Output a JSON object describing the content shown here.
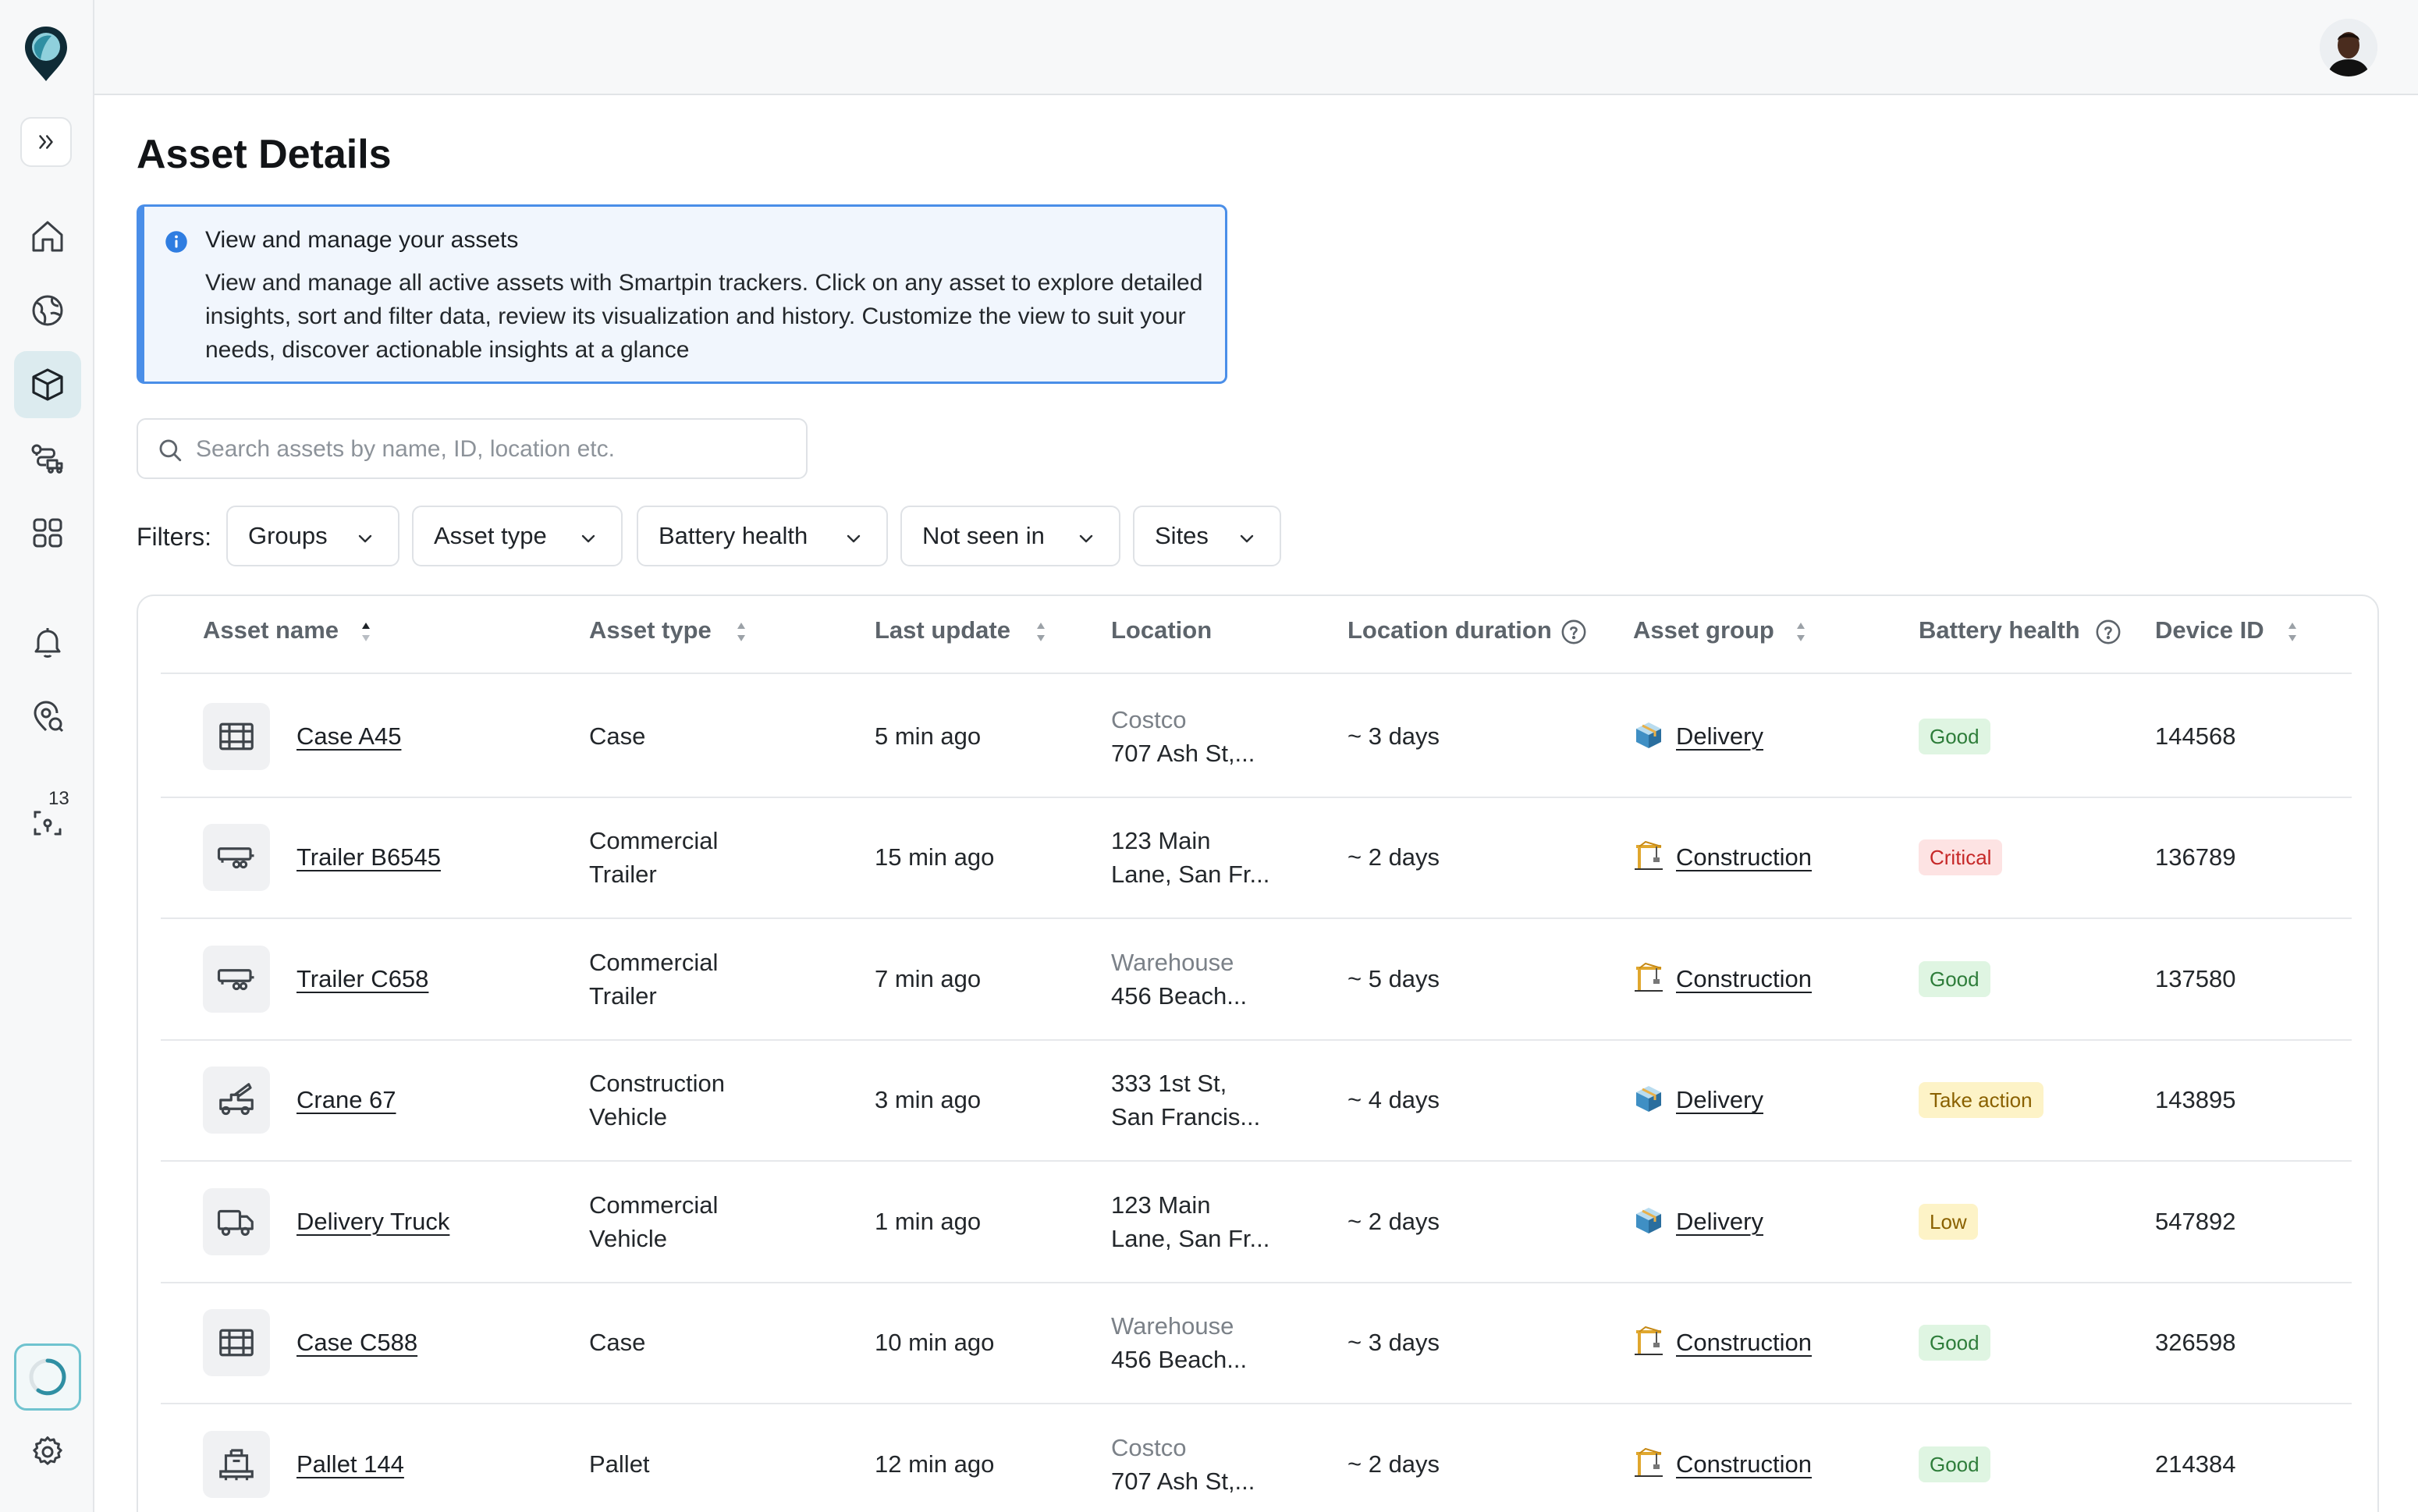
{
  "sidebar": {
    "badge_count": "13",
    "nav": [
      {
        "name": "home",
        "icon": "home-icon"
      },
      {
        "name": "globe",
        "icon": "globe-icon"
      },
      {
        "name": "assets",
        "icon": "cube-icon",
        "active": true
      },
      {
        "name": "routes",
        "icon": "truck-route-icon"
      },
      {
        "name": "apps",
        "icon": "grid-icon"
      },
      {
        "name": "alerts",
        "icon": "bell-icon"
      },
      {
        "name": "location",
        "icon": "pin-icon"
      },
      {
        "name": "scan",
        "icon": "scan-icon"
      }
    ]
  },
  "page": {
    "title": "Asset Details"
  },
  "info": {
    "title": "View and manage your assets",
    "body": "View and manage all active assets with Smartpin trackers. Click on any asset to explore detailed insights, sort and filter data, review its visualization and history. Customize the view to suit your needs, discover actionable insights at a glance"
  },
  "search": {
    "placeholder": "Search assets by name, ID, location etc."
  },
  "filters": {
    "label": "Filters:",
    "items": [
      "Groups",
      "Asset type",
      "Battery health",
      "Not seen in",
      "Sites"
    ]
  },
  "table": {
    "columns": [
      "Asset name",
      "Asset type",
      "Last update",
      "Location",
      "Location duration",
      "Asset group",
      "Battery health",
      "Device ID"
    ],
    "rows": [
      {
        "name": "Case A45",
        "icon": "case-icon",
        "type1": "Case",
        "type2": "",
        "updated": "5 min ago",
        "loc1": "Costco",
        "loc1_muted": true,
        "loc2": "707 Ash St,...",
        "duration": "~ 3 days",
        "group": "Delivery",
        "group_icon": "box-icon",
        "battery": "Good",
        "battery_class": "good",
        "device": "144568"
      },
      {
        "name": "Trailer B6545",
        "icon": "trailer-icon",
        "type1": "Commercial",
        "type2": "Trailer",
        "updated": "15 min ago",
        "loc1": "123 Main",
        "loc1_muted": false,
        "loc2": "Lane, San Fr...",
        "duration": "~ 2 days",
        "group": "Construction",
        "group_icon": "crane-icon",
        "battery": "Critical",
        "battery_class": "critical",
        "device": "136789"
      },
      {
        "name": "Trailer C658",
        "icon": "trailer-icon",
        "type1": "Commercial",
        "type2": "Trailer",
        "updated": "7 min ago",
        "loc1": "Warehouse",
        "loc1_muted": true,
        "loc2": "456 Beach...",
        "duration": "~ 5 days",
        "group": "Construction",
        "group_icon": "crane-icon",
        "battery": "Good",
        "battery_class": "good",
        "device": "137580"
      },
      {
        "name": "Crane 67",
        "icon": "crane-truck-icon",
        "type1": "Construction",
        "type2": "Vehicle",
        "updated": "3 min ago",
        "loc1": "333 1st St,",
        "loc1_muted": false,
        "loc2": "San Francis...",
        "duration": "~ 4 days",
        "group": "Delivery",
        "group_icon": "box-icon",
        "battery": "Take action",
        "battery_class": "take",
        "device": "143895"
      },
      {
        "name": "Delivery Truck",
        "icon": "truck-icon",
        "type1": "Commercial",
        "type2": "Vehicle",
        "updated": "1 min ago",
        "loc1": "123 Main",
        "loc1_muted": false,
        "loc2": "Lane, San Fr...",
        "duration": "~ 2 days",
        "group": "Delivery",
        "group_icon": "box-icon",
        "battery": "Low",
        "battery_class": "low",
        "device": "547892"
      },
      {
        "name": "Case C588",
        "icon": "case-icon",
        "type1": "Case",
        "type2": "",
        "updated": "10 min ago",
        "loc1": "Warehouse",
        "loc1_muted": true,
        "loc2": "456 Beach...",
        "duration": "~ 3 days",
        "group": "Construction",
        "group_icon": "crane-icon",
        "battery": "Good",
        "battery_class": "good",
        "device": "326598"
      },
      {
        "name": "Pallet 144",
        "icon": "pallet-icon",
        "type1": "Pallet",
        "type2": "",
        "updated": "12 min ago",
        "loc1": "Costco",
        "loc1_muted": true,
        "loc2": "707 Ash St,...",
        "duration": "~ 2 days",
        "group": "Construction",
        "group_icon": "crane-icon",
        "battery": "Good",
        "battery_class": "good",
        "device": "214384"
      }
    ]
  },
  "colors": {
    "accent": "#4a8ee8",
    "active_nav": "#dcebef",
    "good": "#2e7d3a",
    "critical": "#c62828",
    "warning": "#8a6100"
  }
}
